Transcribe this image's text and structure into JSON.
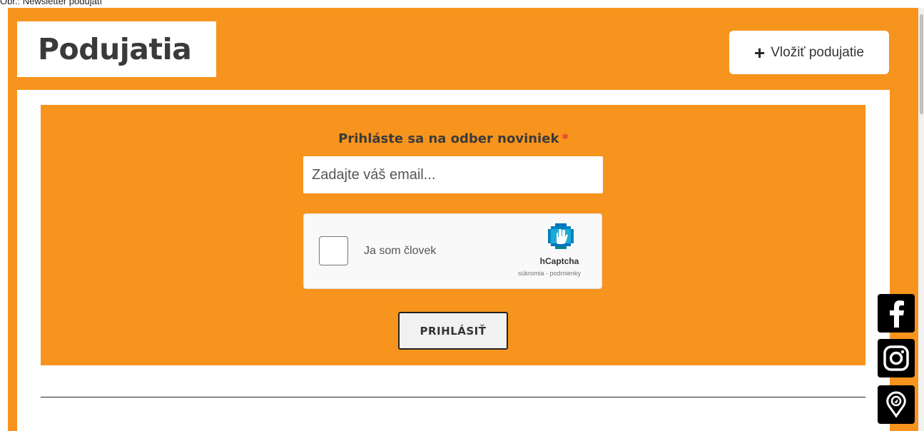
{
  "caption": "Obr.: Newsletter podujatí",
  "header": {
    "title": "Podujatia",
    "add_button_label": "Vložiť podujatie"
  },
  "newsletter": {
    "label": "Prihláste sa na odber noviniek",
    "required_marker": "*",
    "email_placeholder": "Zadajte váš email...",
    "submit_label": "PRIHLÁSIŤ"
  },
  "captcha": {
    "checkbox_label": "Ja som človek",
    "brand": "hCaptcha",
    "privacy_link": "súkromia",
    "separator": " - ",
    "terms_link": "podmienky"
  },
  "social": {
    "items": [
      "facebook-icon",
      "instagram-icon",
      "map-pin-icon"
    ]
  },
  "colors": {
    "accent": "#f7941d",
    "text_dark": "#3a3a3a",
    "required": "#e53935"
  }
}
